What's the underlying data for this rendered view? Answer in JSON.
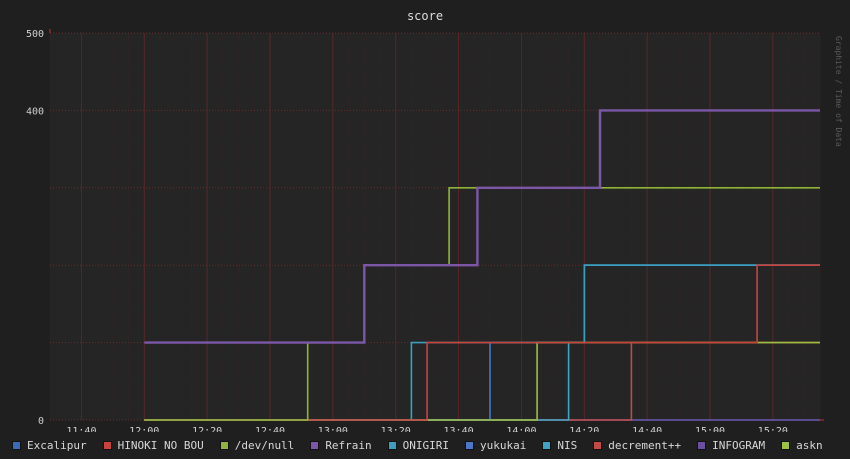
{
  "chart_data": {
    "type": "line",
    "step": true,
    "title": "score",
    "watermark": "Graphite / Time of Data",
    "ylim": [
      0,
      500
    ],
    "y_ticks": [
      0,
      400,
      500
    ],
    "xlim": [
      "11:30",
      "15:35"
    ],
    "x_ticks": [
      "11:40",
      "12:00",
      "12:20",
      "12:40",
      "13:00",
      "13:20",
      "13:40",
      "14:00",
      "14:20",
      "14:40",
      "15:00",
      "15:20"
    ],
    "grid": true,
    "legend_position": "bottom",
    "series": [
      {
        "name": "Excalipur",
        "color": "#3a6ab8",
        "points": [
          [
            "12:00",
            0
          ],
          [
            "15:35",
            0
          ]
        ]
      },
      {
        "name": "HINOKI NO BOU",
        "color": "#c8433d",
        "points": [
          [
            "12:00",
            0
          ],
          [
            "13:30",
            0
          ],
          [
            "13:30",
            100
          ],
          [
            "15:15",
            100
          ],
          [
            "15:15",
            200
          ],
          [
            "15:35",
            200
          ]
        ]
      },
      {
        "name": "/dev/null",
        "color": "#8fb43a",
        "points": [
          [
            "12:00",
            0
          ],
          [
            "12:52",
            0
          ],
          [
            "12:52",
            100
          ],
          [
            "13:10",
            100
          ],
          [
            "13:10",
            200
          ],
          [
            "13:37",
            200
          ],
          [
            "13:37",
            300
          ],
          [
            "15:35",
            300
          ]
        ]
      },
      {
        "name": "Refrain",
        "color": "#7c57a8",
        "points": [
          [
            "12:00",
            100
          ],
          [
            "13:10",
            100
          ],
          [
            "13:10",
            200
          ],
          [
            "13:46",
            200
          ],
          [
            "13:46",
            300
          ],
          [
            "14:25",
            300
          ],
          [
            "14:25",
            400
          ],
          [
            "15:35",
            400
          ]
        ]
      },
      {
        "name": "ONIGIRI",
        "color": "#3aa0c0",
        "points": [
          [
            "12:00",
            0
          ],
          [
            "13:25",
            0
          ],
          [
            "13:25",
            100
          ],
          [
            "14:20",
            100
          ],
          [
            "14:20",
            200
          ],
          [
            "15:35",
            200
          ]
        ]
      },
      {
        "name": "yukukai",
        "color": "#4a78c6",
        "points": [
          [
            "12:00",
            0
          ],
          [
            "13:50",
            0
          ],
          [
            "13:50",
            100
          ],
          [
            "14:20",
            100
          ],
          [
            "14:20",
            200
          ],
          [
            "15:35",
            200
          ]
        ]
      },
      {
        "name": "NIS",
        "color": "#42a4c4",
        "points": [
          [
            "12:00",
            0
          ],
          [
            "14:15",
            0
          ],
          [
            "14:15",
            100
          ],
          [
            "14:20",
            100
          ],
          [
            "14:20",
            200
          ],
          [
            "15:35",
            200
          ]
        ]
      },
      {
        "name": "decrement++",
        "color": "#c24a44",
        "points": [
          [
            "12:00",
            0
          ],
          [
            "14:35",
            0
          ],
          [
            "14:35",
            100
          ],
          [
            "15:35",
            100
          ]
        ]
      },
      {
        "name": "INFOGRAM",
        "color": "#6a4f9e",
        "points": [
          [
            "12:00",
            0
          ],
          [
            "15:35",
            0
          ]
        ]
      },
      {
        "name": "askn",
        "color": "#9bc040",
        "points": [
          [
            "12:00",
            0
          ],
          [
            "14:05",
            0
          ],
          [
            "14:05",
            100
          ],
          [
            "15:35",
            100
          ]
        ]
      }
    ]
  }
}
